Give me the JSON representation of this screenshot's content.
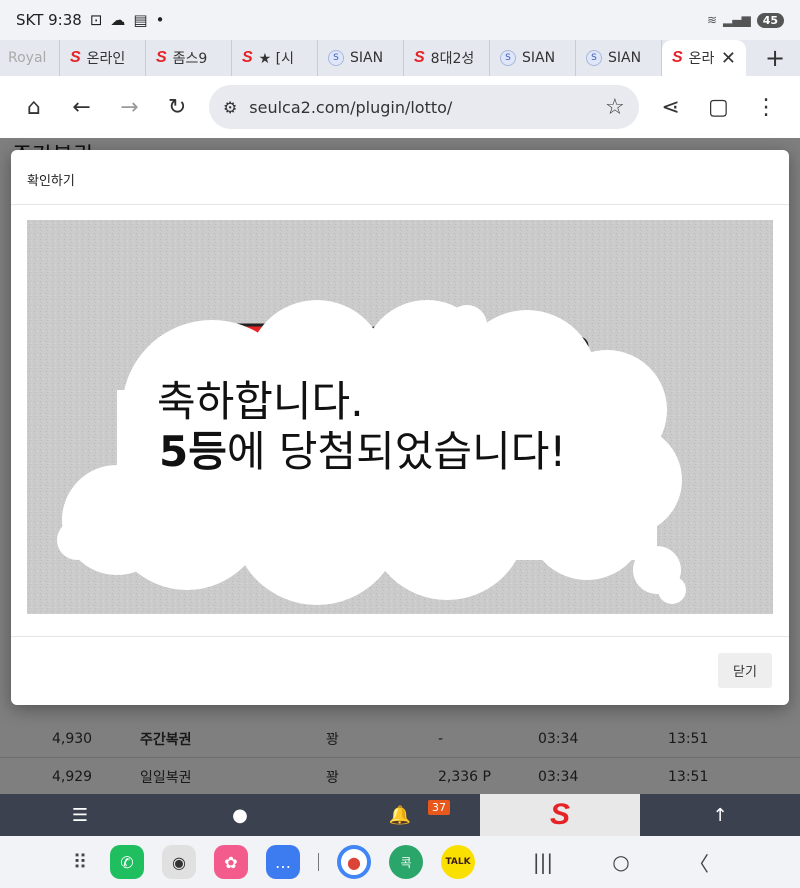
{
  "status_bar": {
    "carrier_time": "SKT 9:38",
    "battery": "45"
  },
  "tabs": [
    {
      "label": "Royal",
      "favicon": "none"
    },
    {
      "label": "온라인",
      "favicon": "s-logo"
    },
    {
      "label": "좀스9",
      "favicon": "s-logo"
    },
    {
      "label": "★ [시",
      "favicon": "s-logo"
    },
    {
      "label": "SIAN",
      "favicon": "sian"
    },
    {
      "label": "8대2성",
      "favicon": "s-logo"
    },
    {
      "label": "SIAN",
      "favicon": "sian"
    },
    {
      "label": "SIAN",
      "favicon": "sian"
    },
    {
      "label": "온라",
      "favicon": "s-logo",
      "active": true
    }
  ],
  "toolbar": {
    "url": "seulca2.com/plugin/lotto/"
  },
  "page": {
    "heading": "주간복권",
    "rows": [
      {
        "no": "4,930",
        "type": "주간복권",
        "result": "꽝",
        "points": "-",
        "time1": "03:34",
        "time2": "13:51"
      },
      {
        "no": "4,929",
        "type": "일일복권",
        "result": "꽝",
        "points": "2,336 P",
        "time1": "03:34",
        "time2": "13:51"
      }
    ]
  },
  "modal": {
    "title": "확인하기",
    "message_line1": "축하합니다.",
    "message_line2_bold": "5등",
    "message_line2_rest": "에 당첨되었습니다!",
    "close_label": "닫기"
  },
  "site_bar": {
    "notification_count": "37"
  },
  "android_nav": {
    "apps": [
      "phone",
      "camera",
      "gallery",
      "messages",
      "chrome",
      "kakaomap",
      "kakaotalk"
    ],
    "kakaomap_label": "콕",
    "kakaotalk_label": "TALK"
  },
  "colors": {
    "brand_red": "#e52226",
    "site_bar": "#3c4150",
    "badge": "#e8581c"
  }
}
